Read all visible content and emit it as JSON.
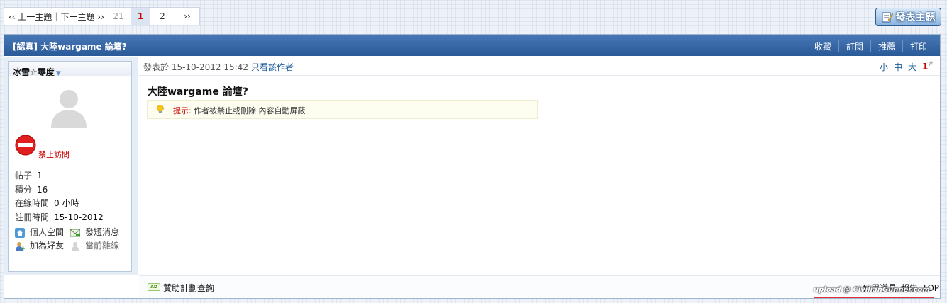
{
  "topnav": {
    "prev_label": "‹‹ 上一主題",
    "next_label": "下一主題 ››"
  },
  "pager": {
    "pages": [
      "21",
      "1",
      "2",
      "››"
    ],
    "current": "1"
  },
  "new_post_button": "發表主題",
  "thread": {
    "title": "[認真] 大陸wargame 論壇?",
    "actions": [
      "收藏",
      "訂閱",
      "推薦",
      "打印"
    ]
  },
  "author": {
    "name": "冰雪☆零度",
    "status": "禁止訪問",
    "stats": [
      {
        "label": "帖子",
        "value": "1"
      },
      {
        "label": "積分",
        "value": "16"
      },
      {
        "label": "在線時間",
        "value": "0 小時"
      },
      {
        "label": "註冊時間",
        "value": "15-10-2012"
      }
    ],
    "links": [
      {
        "label": "個人空間",
        "icon": "home-icon"
      },
      {
        "label": "發短消息",
        "icon": "message-icon"
      },
      {
        "label": "加為好友",
        "icon": "add-friend-icon"
      },
      {
        "label": "當前離線",
        "icon": "offline-user-icon"
      }
    ]
  },
  "post": {
    "posted_prefix": "發表於 15-10-2012 15:42",
    "only_author": "只看該作者",
    "font_sizes": [
      "小",
      "中",
      "大"
    ],
    "floor": "1",
    "floor_mark": "#",
    "subject": "大陸wargame 論壇?",
    "notice_label": "提示:",
    "notice_text": "作者被禁止或刪除 內容自動屏蔽"
  },
  "footer": {
    "ad_badge": "AD",
    "ad_text": "贊助計劃查詢",
    "tools": [
      "使用道具",
      "報告",
      "TOP"
    ]
  },
  "watermark": "upload @ CivilianGunner.com",
  "colors": {
    "title_bar": "#2b5a99",
    "accent_link": "#1f5b99",
    "alert_red": "#cc0000"
  }
}
